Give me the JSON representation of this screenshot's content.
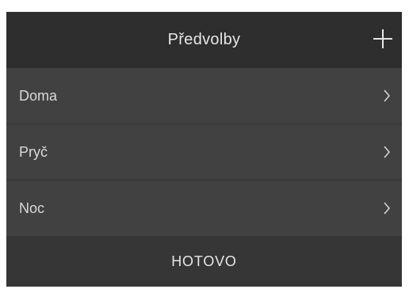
{
  "header": {
    "title": "Předvolby",
    "add_icon": "plus-icon"
  },
  "presets": [
    {
      "label": "Doma",
      "icon": "chevron-right-icon"
    },
    {
      "label": "Pryč",
      "icon": "chevron-right-icon"
    },
    {
      "label": "Noc",
      "icon": "chevron-right-icon"
    }
  ],
  "footer": {
    "done_label": "HOTOVO"
  },
  "colors": {
    "header_bg": "#2e2e2e",
    "row_bg": "#414141",
    "footer_bg": "#363636",
    "text": "#e6e6e6"
  }
}
